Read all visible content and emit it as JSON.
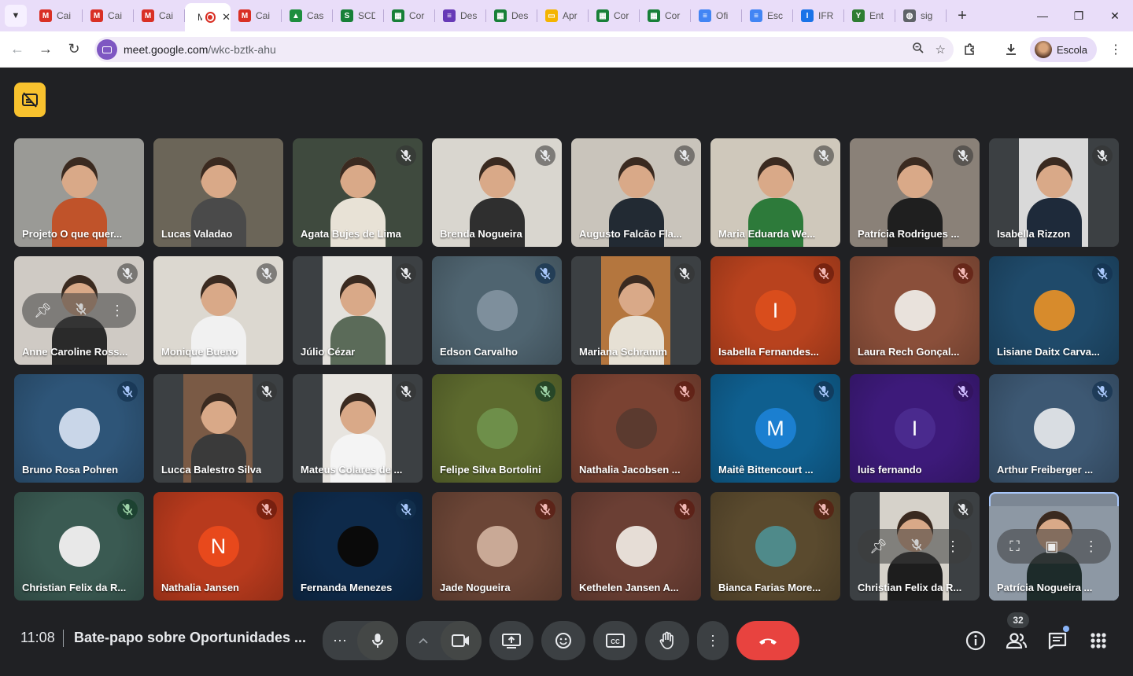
{
  "browser": {
    "tabs": [
      {
        "name": "gmail",
        "label": "Cai",
        "icon": "gmail-icon",
        "color": "#d93025",
        "glyph": "M"
      },
      {
        "name": "gmail",
        "label": "Cai",
        "icon": "gmail-icon",
        "color": "#d93025",
        "glyph": "M"
      },
      {
        "name": "gmail",
        "label": "Cai",
        "icon": "gmail-icon",
        "color": "#d93025",
        "glyph": "M"
      },
      {
        "name": "meet",
        "label": "M",
        "icon": "recording-icon",
        "color": "#d93025",
        "glyph": "",
        "active": true
      },
      {
        "name": "gmail",
        "label": "Cai",
        "icon": "gmail-icon",
        "color": "#d93025",
        "glyph": "M"
      },
      {
        "name": "drive",
        "label": "Cas",
        "icon": "drive-icon",
        "color": "#1e8e3e",
        "glyph": "▲"
      },
      {
        "name": "scd",
        "label": "SCD",
        "icon": "scd-icon",
        "color": "#188038",
        "glyph": "S"
      },
      {
        "name": "sheets",
        "label": "Cor",
        "icon": "sheets-icon",
        "color": "#188038",
        "glyph": "▦"
      },
      {
        "name": "forms",
        "label": "Des",
        "icon": "forms-icon",
        "color": "#673ab7",
        "glyph": "≡"
      },
      {
        "name": "sheets",
        "label": "Des",
        "icon": "sheets-icon",
        "color": "#188038",
        "glyph": "▦"
      },
      {
        "name": "slides",
        "label": "Apr",
        "icon": "slides-icon",
        "color": "#f4b400",
        "glyph": "▭"
      },
      {
        "name": "sheets",
        "label": "Cor",
        "icon": "sheets-icon",
        "color": "#188038",
        "glyph": "▦"
      },
      {
        "name": "sheets",
        "label": "Cor",
        "icon": "sheets-icon",
        "color": "#188038",
        "glyph": "▦"
      },
      {
        "name": "docs",
        "label": "Ofi",
        "icon": "docs-icon",
        "color": "#4285f4",
        "glyph": "≡"
      },
      {
        "name": "docs",
        "label": "Esc",
        "icon": "docs-icon",
        "color": "#4285f4",
        "glyph": "≡"
      },
      {
        "name": "ifrs",
        "label": "IFR",
        "icon": "ifrs-icon",
        "color": "#1a73e8",
        "glyph": "I"
      },
      {
        "name": "ent",
        "label": "Ent",
        "icon": "ent-icon",
        "color": "#2e7d32",
        "glyph": "Y"
      },
      {
        "name": "sig",
        "label": "sig",
        "icon": "globe-icon",
        "color": "#5f6368",
        "glyph": "◍"
      }
    ],
    "active_close": "✕",
    "new_tab": "+",
    "url_host": "meet.google.com",
    "url_path": "/wkc-bztk-ahu",
    "profile_name": "Escola"
  },
  "meet": {
    "time": "11:08",
    "meeting_title": "Bate-papo sobre Oportunidades ...",
    "participant_count": "32",
    "tiles": [
      {
        "name": "Projeto O que quer...",
        "kind": "video",
        "bg": "#9a9a96",
        "body": "#c0532a",
        "muted": false
      },
      {
        "name": "Lucas Valadao",
        "kind": "video",
        "bg": "#6b6558",
        "body": "#4a4a4a",
        "muted": false
      },
      {
        "name": "Agata Bujes de Lima",
        "kind": "video",
        "bg": "#3f4a3e",
        "body": "#e8e2d6",
        "muted": true
      },
      {
        "name": "Brenda Nogueira",
        "kind": "video",
        "bg": "#d9d6cf",
        "body": "#2f2f2f",
        "muted": true
      },
      {
        "name": "Augusto Falcão Fla...",
        "kind": "video",
        "bg": "#c9c4bb",
        "body": "#222a33",
        "muted": true
      },
      {
        "name": "Maria Eduarda We...",
        "kind": "video",
        "bg": "#cfc8bb",
        "body": "#2d7a3a",
        "muted": true
      },
      {
        "name": "Patrícia Rodrigues ...",
        "kind": "video",
        "bg": "#8a8178",
        "body": "#1f1f1f",
        "muted": true
      },
      {
        "name": "Isabella Rizzon",
        "kind": "framed",
        "bg": "#3c4043",
        "frame": "#d9d9d9",
        "body": "#1e2a3a",
        "muted": true
      },
      {
        "name": "Anne Caroline Ross...",
        "kind": "video",
        "bg": "#cfcac4",
        "body": "#2a2a2a",
        "muted": true,
        "hover": true
      },
      {
        "name": "Monique Bueno",
        "kind": "video",
        "bg": "#dcd8d0",
        "body": "#f1f1f1",
        "muted": true
      },
      {
        "name": "Júlio Cézar",
        "kind": "framed",
        "bg": "#3c4043",
        "frame": "#e3e1dc",
        "body": "#5b6b59",
        "muted": true
      },
      {
        "name": "Edson Carvalho",
        "kind": "avatar",
        "bg": "#4f6470",
        "avatar_bg": "#7e8f9c",
        "muted": true,
        "blue_mute": true
      },
      {
        "name": "Mariana Schramm",
        "kind": "framed",
        "bg": "#3c4043",
        "frame": "#b4763e",
        "body": "#e6e0d4",
        "muted": true
      },
      {
        "name": "Isabella Fernandes...",
        "kind": "letter",
        "bg": "#b8421e",
        "avatar_bg": "#d94d1c",
        "letter": "I",
        "muted": true,
        "red_mute": true
      },
      {
        "name": "Laura Rech Gonçal...",
        "kind": "avatar",
        "bg": "#8a4f3a",
        "avatar_bg": "#e9e2dc",
        "muted": true,
        "red_mute": true
      },
      {
        "name": "Lisiane Daitx Carva...",
        "kind": "avatar",
        "bg": "#1f4a6a",
        "avatar_bg": "#d78b2c",
        "muted": true,
        "blue_mute": true
      },
      {
        "name": "Bruno Rosa Pohren",
        "kind": "avatar",
        "bg": "#2e5578",
        "avatar_bg": "#c9d6e8",
        "muted": true,
        "blue_mute": true
      },
      {
        "name": "Lucca Balestro Silva",
        "kind": "framed",
        "bg": "#3c4043",
        "frame": "#7a5a45",
        "body": "#3a3a3a",
        "muted": true
      },
      {
        "name": "Mateus Colares de ...",
        "kind": "framed",
        "bg": "#3c4043",
        "frame": "#e7e4df",
        "body": "#f4f4f4",
        "muted": true
      },
      {
        "name": "Felipe Silva Bortolini",
        "kind": "avatar",
        "bg": "#5d6a2e",
        "avatar_bg": "#6e8f4a",
        "muted": true,
        "green_mute": true
      },
      {
        "name": "Nathalia Jacobsen ...",
        "kind": "avatar",
        "bg": "#7a4232",
        "avatar_bg": "#5b3a2f",
        "muted": true,
        "red_mute": true
      },
      {
        "name": "Maitê Bittencourt ...",
        "kind": "letter",
        "bg": "#0f5f8f",
        "avatar_bg": "#1b7fd0",
        "letter": "M",
        "muted": true,
        "blue_mute": true
      },
      {
        "name": "luis fernando",
        "kind": "letter",
        "bg": "#3d1a7a",
        "avatar_bg": "#4a2a8e",
        "letter": "I",
        "muted": true,
        "purple_mute": true
      },
      {
        "name": "Arthur Freiberger ...",
        "kind": "avatar",
        "bg": "#3d5873",
        "avatar_bg": "#d9dde2",
        "muted": true,
        "blue_mute": true
      },
      {
        "name": "Christian Felix da R...",
        "kind": "avatar",
        "bg": "#3a5a52",
        "avatar_bg": "#e8e8e8",
        "muted": true,
        "green_mute": true
      },
      {
        "name": "Nathalia Jansen",
        "kind": "letter",
        "bg": "#b83a1d",
        "avatar_bg": "#e8491c",
        "letter": "N",
        "muted": true,
        "red_mute": true
      },
      {
        "name": "Fernanda Menezes",
        "kind": "avatar",
        "bg": "#0e2a4a",
        "avatar_bg": "#0a0a0a",
        "muted": true,
        "blue_mute": true
      },
      {
        "name": "Jade Nogueira",
        "kind": "avatar",
        "bg": "#6b4536",
        "avatar_bg": "#c9a996",
        "muted": true,
        "red_mute": true
      },
      {
        "name": "Kethelen Jansen A...",
        "kind": "avatar",
        "bg": "#6b3f34",
        "avatar_bg": "#e6ddd6",
        "muted": true,
        "red_mute": true
      },
      {
        "name": "Bianca Farias More...",
        "kind": "avatar",
        "bg": "#5a4a2e",
        "avatar_bg": "#4f8a8a",
        "muted": true,
        "red_mute": true
      },
      {
        "name": "Christian Felix da R...",
        "kind": "framed",
        "bg": "#3c4043",
        "frame": "#d6d2ca",
        "body": "#1d1d1d",
        "muted": true,
        "hover": true
      },
      {
        "name": "Patrícia Nogueira ...",
        "kind": "self",
        "bg": "#7c8794",
        "frame": "#8d98a4",
        "body": "#1d2b2a",
        "muted": false,
        "selected": true
      }
    ]
  }
}
